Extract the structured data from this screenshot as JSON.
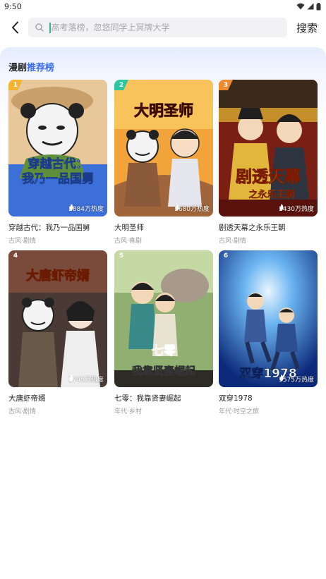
{
  "status_bar": {
    "time": "9:50"
  },
  "header": {
    "search_placeholder": "高考落榜，忽悠同学上冥牌大学",
    "search_label": "搜索"
  },
  "panel": {
    "title_part1": "漫剧",
    "title_part2": "推荐榜"
  },
  "colors": {
    "accent": "#3a6cf4",
    "cursor": "#3bb08f"
  },
  "items": [
    {
      "rank": "1",
      "heat": "2884万热度",
      "title": "穿越古代：我乃一品国舅",
      "tags": "古风·剧情",
      "cover_text": "穿越古代：\n我乃一品国舅"
    },
    {
      "rank": "2",
      "heat": "2680万热度",
      "title": "大明圣师",
      "tags": "古风·喜剧",
      "cover_text": "大明圣师"
    },
    {
      "rank": "3",
      "heat": "2430万热度",
      "title": "剧透天幕之永乐王朝",
      "tags": "古风·剧情",
      "cover_text": "剧透天幕",
      "cover_sub": "之永乐王朝"
    },
    {
      "rank": "4",
      "heat": "2745万热度",
      "title": "大唐虾帝婿",
      "tags": "古风·剧情",
      "cover_text": "大唐虾帝婿"
    },
    {
      "rank": "5",
      "heat": "",
      "title": "七零：我靠贤妻崛起",
      "tags": "年代·乡村",
      "cover_text": "我靠贤妻崛起",
      "cover_sub": "七零"
    },
    {
      "rank": "6",
      "heat": "3575万热度",
      "title": "双穿1978",
      "tags": "年代·时空之旅",
      "cover_text": "双穿1978"
    }
  ]
}
